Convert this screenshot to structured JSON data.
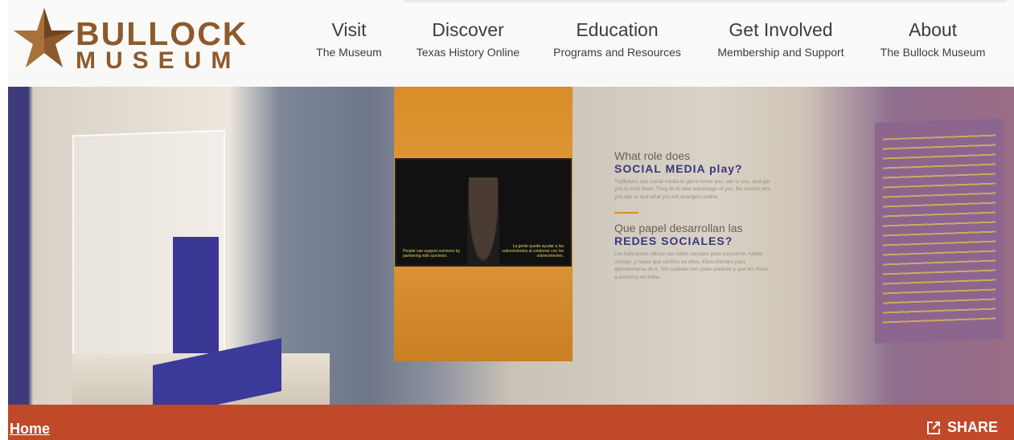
{
  "logo": {
    "line1": "BULLOCK",
    "line2": "MUSEUM",
    "star_color": "#8e5a2c"
  },
  "nav": [
    {
      "label": "Visit",
      "sub": "The Museum"
    },
    {
      "label": "Discover",
      "sub": "Texas History Online"
    },
    {
      "label": "Education",
      "sub": "Programs and Resources"
    },
    {
      "label": "Get Involved",
      "sub": "Membership and Support"
    },
    {
      "label": "About",
      "sub": "The Bullock Museum"
    }
  ],
  "hero": {
    "wall_heading_1": "What role does",
    "wall_heading_1b": "SOCIAL MEDIA play?",
    "wall_body_1": "Traffickers use social media to get to know you, talk to you, and get you to trust them. They lie to take advantage of you. Be careful who you talk to and what you tell strangers online.",
    "wall_heading_2": "Que papel desarrollan las",
    "wall_heading_2b": "REDES SOCIALES?",
    "wall_body_2": "Los traficantes utilizan las redes sociales para conocerte, hablar contigo, y hacer que confíes en ellos. Ellos mienten para aprovecharse de ti. Ten cuidado con quien platicas y que les dices a extraños en línea.",
    "tv_sub_left": "People can support survivors by partnering with survivors.",
    "tv_sub_right": "La gente puede ayudar a los sobrevivientes al colaborar con los sobrevivientes."
  },
  "breadcrumb": {
    "home": "Home"
  },
  "share": {
    "label": "SHARE",
    "icon": "share-external-icon"
  },
  "colors": {
    "bar": "#c0492a",
    "brand": "#8e5a2c"
  }
}
